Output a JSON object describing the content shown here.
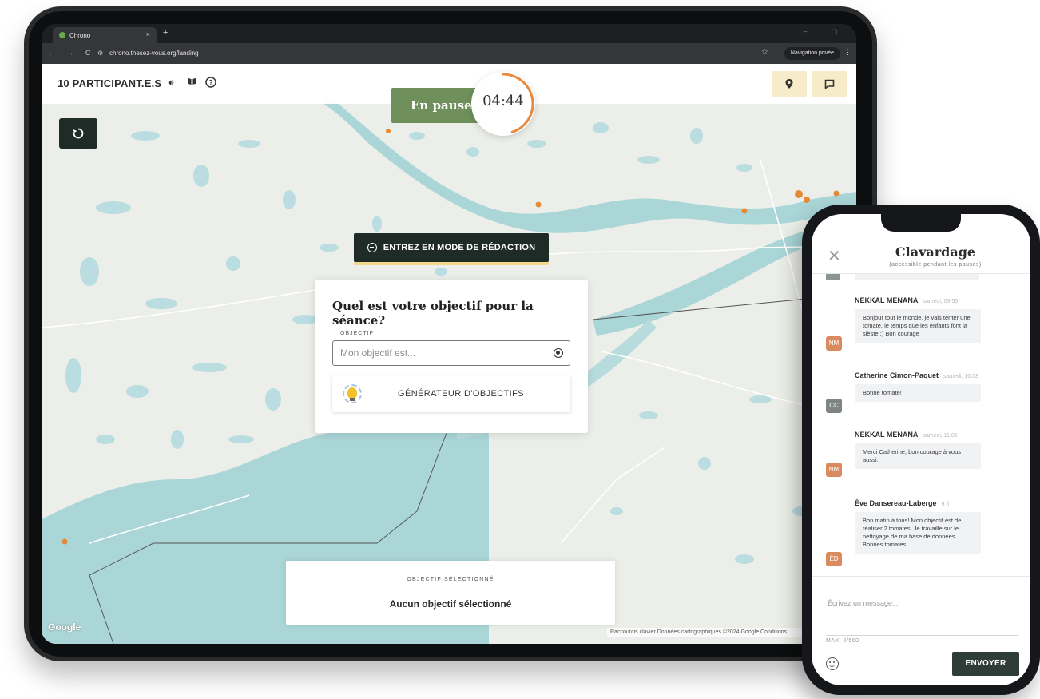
{
  "browser": {
    "tab_title": "Chrono",
    "tab_close": "×",
    "new_tab": "+",
    "window_controls": "– ▢",
    "nav": "← → C",
    "url": "chrono.thesez-vous.org/landing",
    "private_label": "Navigation privée"
  },
  "topbar": {
    "participants": "10 PARTICIPANT.E.S"
  },
  "session": {
    "status": "En pause",
    "timer": "04:44",
    "timer_progress": 0.45
  },
  "draft_mode": {
    "label": "ENTREZ EN MODE DE RÉDACTION"
  },
  "goal": {
    "question": "Quel est votre objectif pour la séance?",
    "field_label": "OBJECTIF",
    "placeholder": "Mon objectif est...",
    "generator_label": "GÉNÉRATEUR D'OBJECTIFS"
  },
  "selected_goal": {
    "label": "OBJECTIF SÉLECTIONNÉ",
    "value": "Aucun objectif sélectionné"
  },
  "map": {
    "attribution": "Raccourcis clavier   Données cartographiques ©2024 Google   Conditions",
    "logo": "Google"
  },
  "chat": {
    "close_label": "✕",
    "title": "Clavardage",
    "subtitle": "(accessible pendant les pauses)",
    "messages": [
      {
        "author": "NEKKAL MENANA",
        "time": "samedi, 09:55",
        "initials": "NM",
        "color": "#d98b5f",
        "text": "Bonjour tout le monde, je vais tenter une tomate, le temps que les enfants font la sièste ;) Bon courage"
      },
      {
        "author": "Catherine Cimon-Paquet",
        "time": "samedi, 10:08",
        "initials": "CC",
        "color": "#7d8481",
        "text": "Bonne tomate!"
      },
      {
        "author": "NEKKAL MENANA",
        "time": "samedi, 11:05",
        "initials": "NM",
        "color": "#d98b5f",
        "text": "Merci Catherine, bon courage à vous aussi."
      },
      {
        "author": "Ève Dansereau-Laberge",
        "time": "9 h",
        "initials": "ÈD",
        "color": "#d98b5f",
        "text": "Bon matin à tous! Mon objectif est de réaliser 2 tomates. Je travaille sur le nettoyage de ma base de données. Bonnes tomates!"
      }
    ],
    "input_placeholder": "Écrivez un message...",
    "max_label": "MAX: 0/500",
    "send_label": "ENVOYER"
  }
}
